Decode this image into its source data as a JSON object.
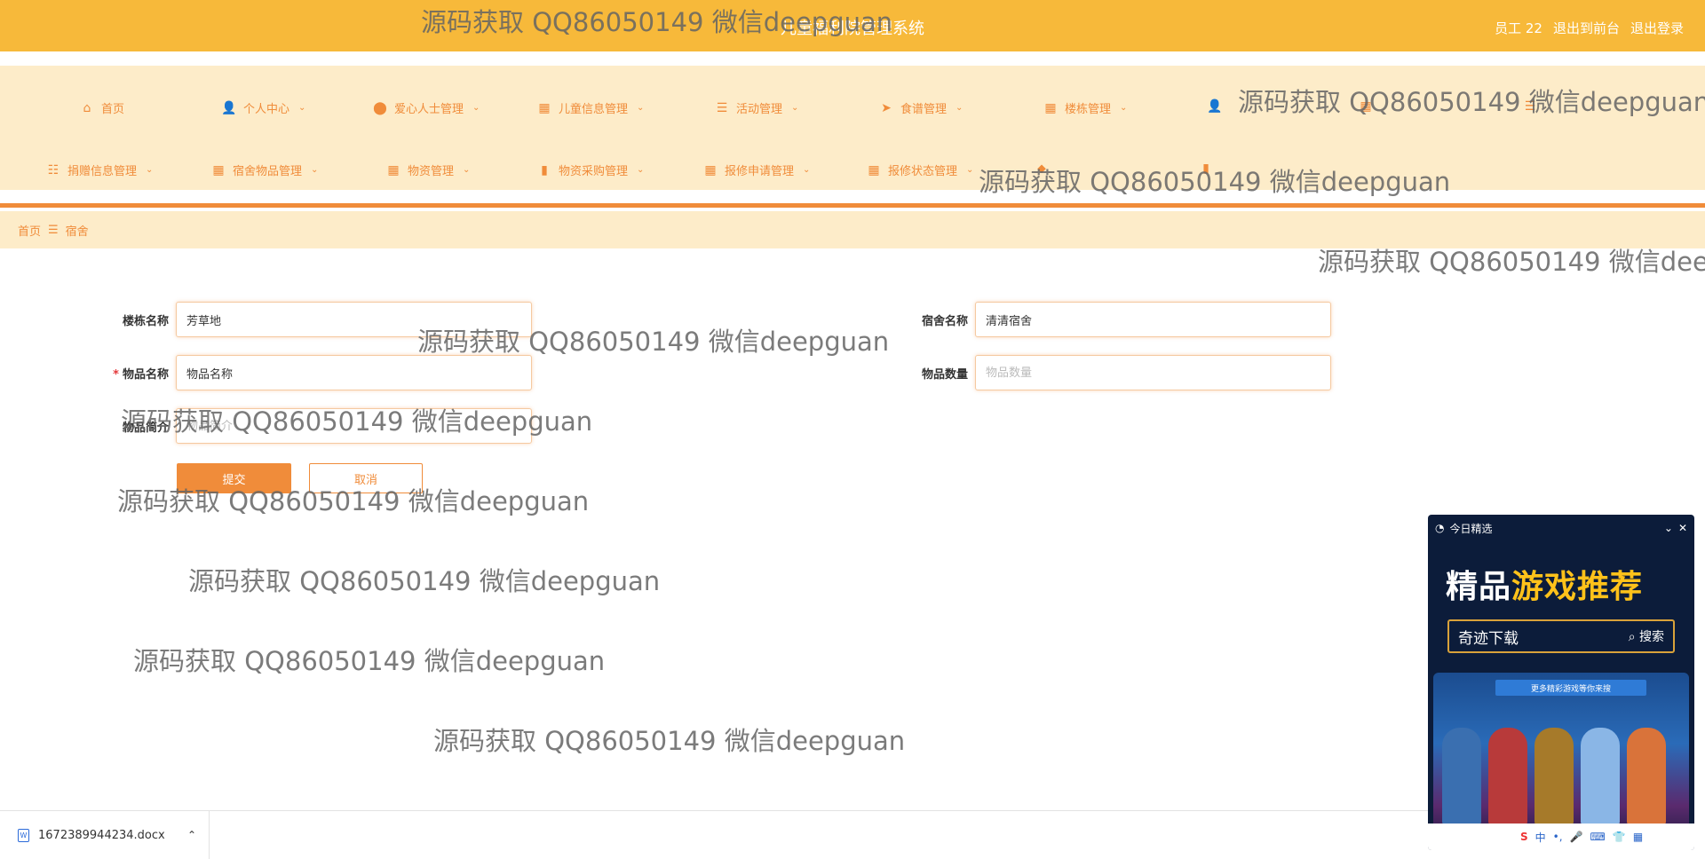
{
  "header": {
    "title": "儿童福利院管理系统",
    "user_links": [
      "员工 22",
      "退出到前台",
      "退出登录"
    ]
  },
  "menu_row1": [
    {
      "label": "首页",
      "icon": "home-icon",
      "has_dropdown": false
    },
    {
      "label": "个人中心",
      "icon": "user-icon",
      "has_dropdown": true
    },
    {
      "label": "爱心人士管理",
      "icon": "location-pin-icon",
      "has_dropdown": true
    },
    {
      "label": "儿童信息管理",
      "icon": "grid-icon",
      "has_dropdown": true
    },
    {
      "label": "活动管理",
      "icon": "list-icon",
      "has_dropdown": true
    },
    {
      "label": "食谱管理",
      "icon": "send-icon",
      "has_dropdown": true
    },
    {
      "label": "楼栋管理",
      "icon": "apps-icon",
      "has_dropdown": true
    },
    {
      "label": "",
      "icon": "user-icon",
      "has_dropdown": false
    },
    {
      "label": "",
      "icon": "apps-icon",
      "has_dropdown": false
    },
    {
      "label": "",
      "icon": "list-icon",
      "has_dropdown": false
    }
  ],
  "menu_row2": [
    {
      "label": "捐赠信息管理",
      "icon": "sliders-icon",
      "has_dropdown": true
    },
    {
      "label": "宿舍物品管理",
      "icon": "apps-icon",
      "has_dropdown": true
    },
    {
      "label": "物资管理",
      "icon": "apps-icon",
      "has_dropdown": true
    },
    {
      "label": "物资采购管理",
      "icon": "bar-chart-icon",
      "has_dropdown": true
    },
    {
      "label": "报修申请管理",
      "icon": "apps-icon",
      "has_dropdown": true
    },
    {
      "label": "报修状态管理",
      "icon": "apps-icon",
      "has_dropdown": true
    },
    {
      "label": "",
      "icon": "tag-icon",
      "has_dropdown": false
    },
    {
      "label": "",
      "icon": "bar-chart-icon",
      "has_dropdown": false
    }
  ],
  "breadcrumb": {
    "home": "首页",
    "separator": "☰",
    "current": "宿舍"
  },
  "form": {
    "building": {
      "label": "楼栋名称",
      "value": "芳草地"
    },
    "dorm": {
      "label": "宿舍名称",
      "value": "清清宿舍"
    },
    "item_name": {
      "label": "物品名称",
      "value": "物品名称",
      "required": true
    },
    "item_qty": {
      "label": "物品数量",
      "value": "",
      "placeholder": "物品数量"
    },
    "item_desc": {
      "label": "物品简介",
      "value": "",
      "placeholder": "物品简介"
    },
    "submit_label": "提交",
    "cancel_label": "取消"
  },
  "watermark_text": "源码获取 QQ86050149 微信deepguan",
  "ad": {
    "header_label": "今日精选",
    "title_white": "精品",
    "title_highlight": "游戏推荐",
    "search_text": "奇迹下载",
    "search_button": "搜索",
    "banner_ribbon": "更多精彩游戏等你来搜",
    "tray_chars": [
      "S",
      "中",
      "•,",
      "🎤",
      "⌨",
      "👕",
      "▦"
    ]
  },
  "download": {
    "filename": "1672389944234.docx"
  },
  "colors": {
    "topbar": "#f7b93a",
    "menu_bg": "#fdecc9",
    "accent": "#f08c3a"
  }
}
